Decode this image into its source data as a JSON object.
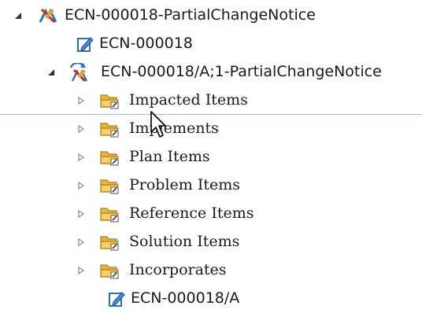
{
  "tree": {
    "root": {
      "label": "ECN-000018-PartialChangeNotice",
      "icon": "change-notice-icon",
      "expanded": true
    },
    "items": [
      {
        "label": "ECN-000018",
        "icon": "document-edit-icon",
        "depth": 1,
        "twisty": "none"
      },
      {
        "label": "ECN-000018/A;1-PartialChangeNotice",
        "icon": "change-notice-revision-icon",
        "depth": 1,
        "twisty": "expanded"
      },
      {
        "label": "Impacted Items",
        "icon": "folder-icon",
        "depth": 2,
        "twisty": "collapsed"
      },
      {
        "label": "Implements",
        "icon": "folder-icon",
        "depth": 2,
        "twisty": "collapsed"
      },
      {
        "label": "Plan Items",
        "icon": "folder-icon",
        "depth": 2,
        "twisty": "collapsed"
      },
      {
        "label": "Problem Items",
        "icon": "folder-icon",
        "depth": 2,
        "twisty": "collapsed"
      },
      {
        "label": "Reference Items",
        "icon": "folder-icon",
        "depth": 2,
        "twisty": "collapsed"
      },
      {
        "label": "Solution Items",
        "icon": "folder-icon",
        "depth": 2,
        "twisty": "collapsed"
      },
      {
        "label": "Incorporates",
        "icon": "folder-icon",
        "depth": 2,
        "twisty": "collapsed"
      },
      {
        "label": "ECN-000018/A",
        "icon": "document-edit-icon",
        "depth": 2,
        "twisty": "none"
      }
    ]
  },
  "colors": {
    "folder": "#e8b43a",
    "folder_dark": "#b07f12",
    "separator": "#a9bbd0",
    "twisty": "#8a8a8a"
  }
}
